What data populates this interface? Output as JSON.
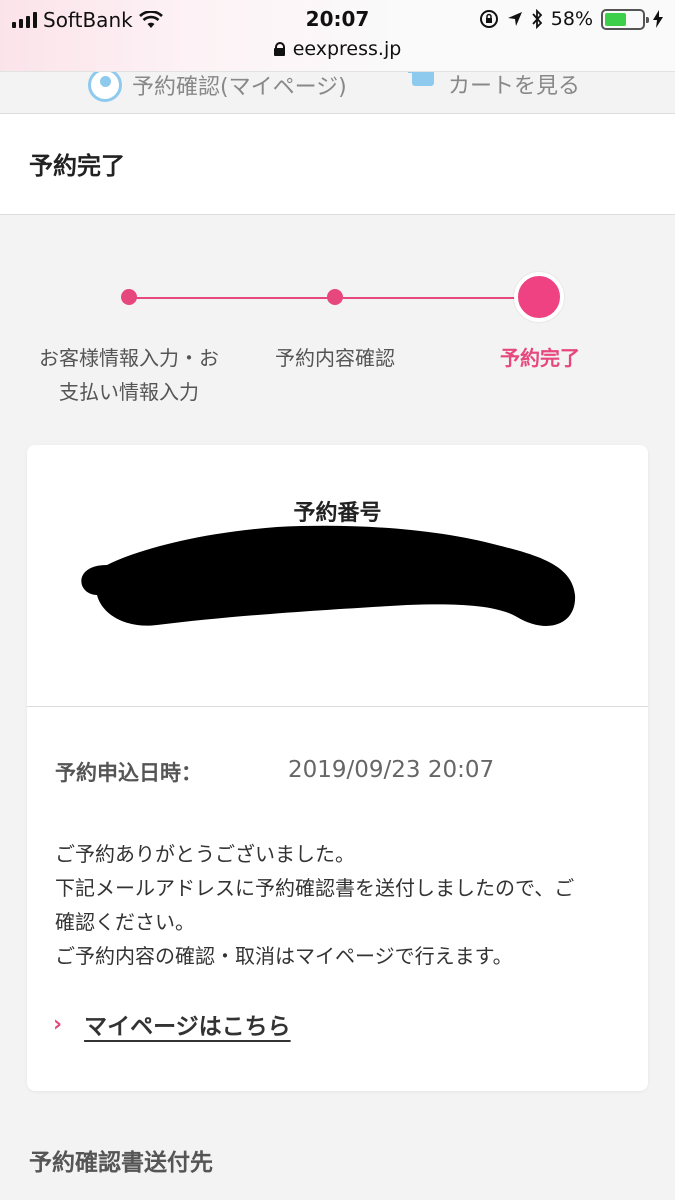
{
  "status_bar": {
    "carrier": "SoftBank",
    "time": "20:07",
    "battery_percent": "58%",
    "battery_level": 0.58,
    "url": "eexpress.jp"
  },
  "top_nav": {
    "mypage_label": "予約確認(マイページ)",
    "cart_label": "カートを見る"
  },
  "page": {
    "title": "予約完了"
  },
  "stepper": {
    "steps": [
      {
        "label_line1": "お客様情報入力・お",
        "label_line2": "支払い情報入力"
      },
      {
        "label_line1": "予約内容確認",
        "label_line2": ""
      },
      {
        "label_line1": "予約完了",
        "label_line2": ""
      }
    ],
    "current_step": 3
  },
  "reservation": {
    "number_label": "予約番号",
    "date_label": "予約申込日時：",
    "date_value": "2019/09/23 20:07",
    "message_lines": [
      "ご予約ありがとうございました。",
      "下記メールアドレスに予約確認書を送付しましたので、ご",
      "確認ください。",
      "ご予約内容の確認・取消はマイページで行えます。"
    ],
    "mypage_link": "マイページはこちら"
  },
  "section": {
    "confirmation_destination": "予約確認書送付先"
  },
  "colors": {
    "accent": "#e6487e",
    "nav_icon": "#8ec9ee",
    "background": "#f3f3f3"
  }
}
